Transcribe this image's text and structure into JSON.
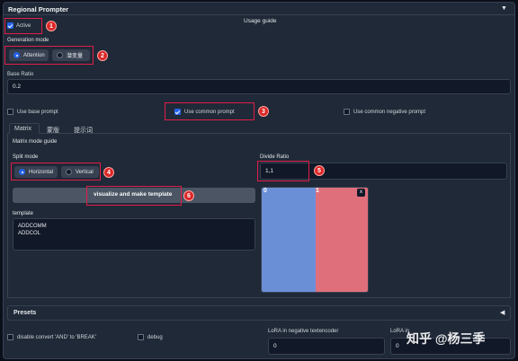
{
  "header": {
    "title": "Regional Prompter",
    "collapse_icon": "triangle-down-icon"
  },
  "usage_guide": "Usage guide",
  "active": {
    "label": "Active",
    "checked": true
  },
  "generation_mode": {
    "label": "Generation mode",
    "options": [
      "Attention",
      "潜变量"
    ],
    "selected": "Attention"
  },
  "base_ratio": {
    "label": "Base Ratio",
    "value": "0.2"
  },
  "checkboxes": {
    "use_base_prompt": {
      "label": "Use base prompt",
      "checked": false
    },
    "use_common_prompt": {
      "label": "Use common prompt",
      "checked": true
    },
    "use_common_negative": {
      "label": "Use common negative prompt",
      "checked": false
    }
  },
  "tabs": [
    "Matrix",
    "蒙版",
    "提示词"
  ],
  "matrix": {
    "guide": "Matrix mode guide",
    "split_mode": {
      "label": "Split mode",
      "options": [
        "Horizontal",
        "Vertical"
      ],
      "selected": "Horizontal"
    },
    "divide_ratio": {
      "label": "Divide Ratio",
      "value": "1,1"
    },
    "visualize_button": "visualize and make template",
    "template": {
      "label": "template",
      "lines": [
        "ADDCOMM",
        "ADDCOL"
      ]
    },
    "preview": {
      "labels": [
        "0",
        "1"
      ],
      "close": "x",
      "colors": [
        "#6b8fd6",
        "#e06f7c"
      ]
    }
  },
  "presets": {
    "label": "Presets",
    "icon": "triangle-left-icon"
  },
  "footer": {
    "disable_convert": "disable convert 'AND' to 'BREAK'",
    "debug": "debug",
    "lora_negative_label": "LoRA in negative textencoder",
    "lora_negative_value": "0",
    "lora_unet_label": "LoRA in",
    "lora_unet_value": "0"
  },
  "annotations": [
    "1",
    "2",
    "3",
    "4",
    "5",
    "6"
  ],
  "watermark": "知乎 @杨三季"
}
